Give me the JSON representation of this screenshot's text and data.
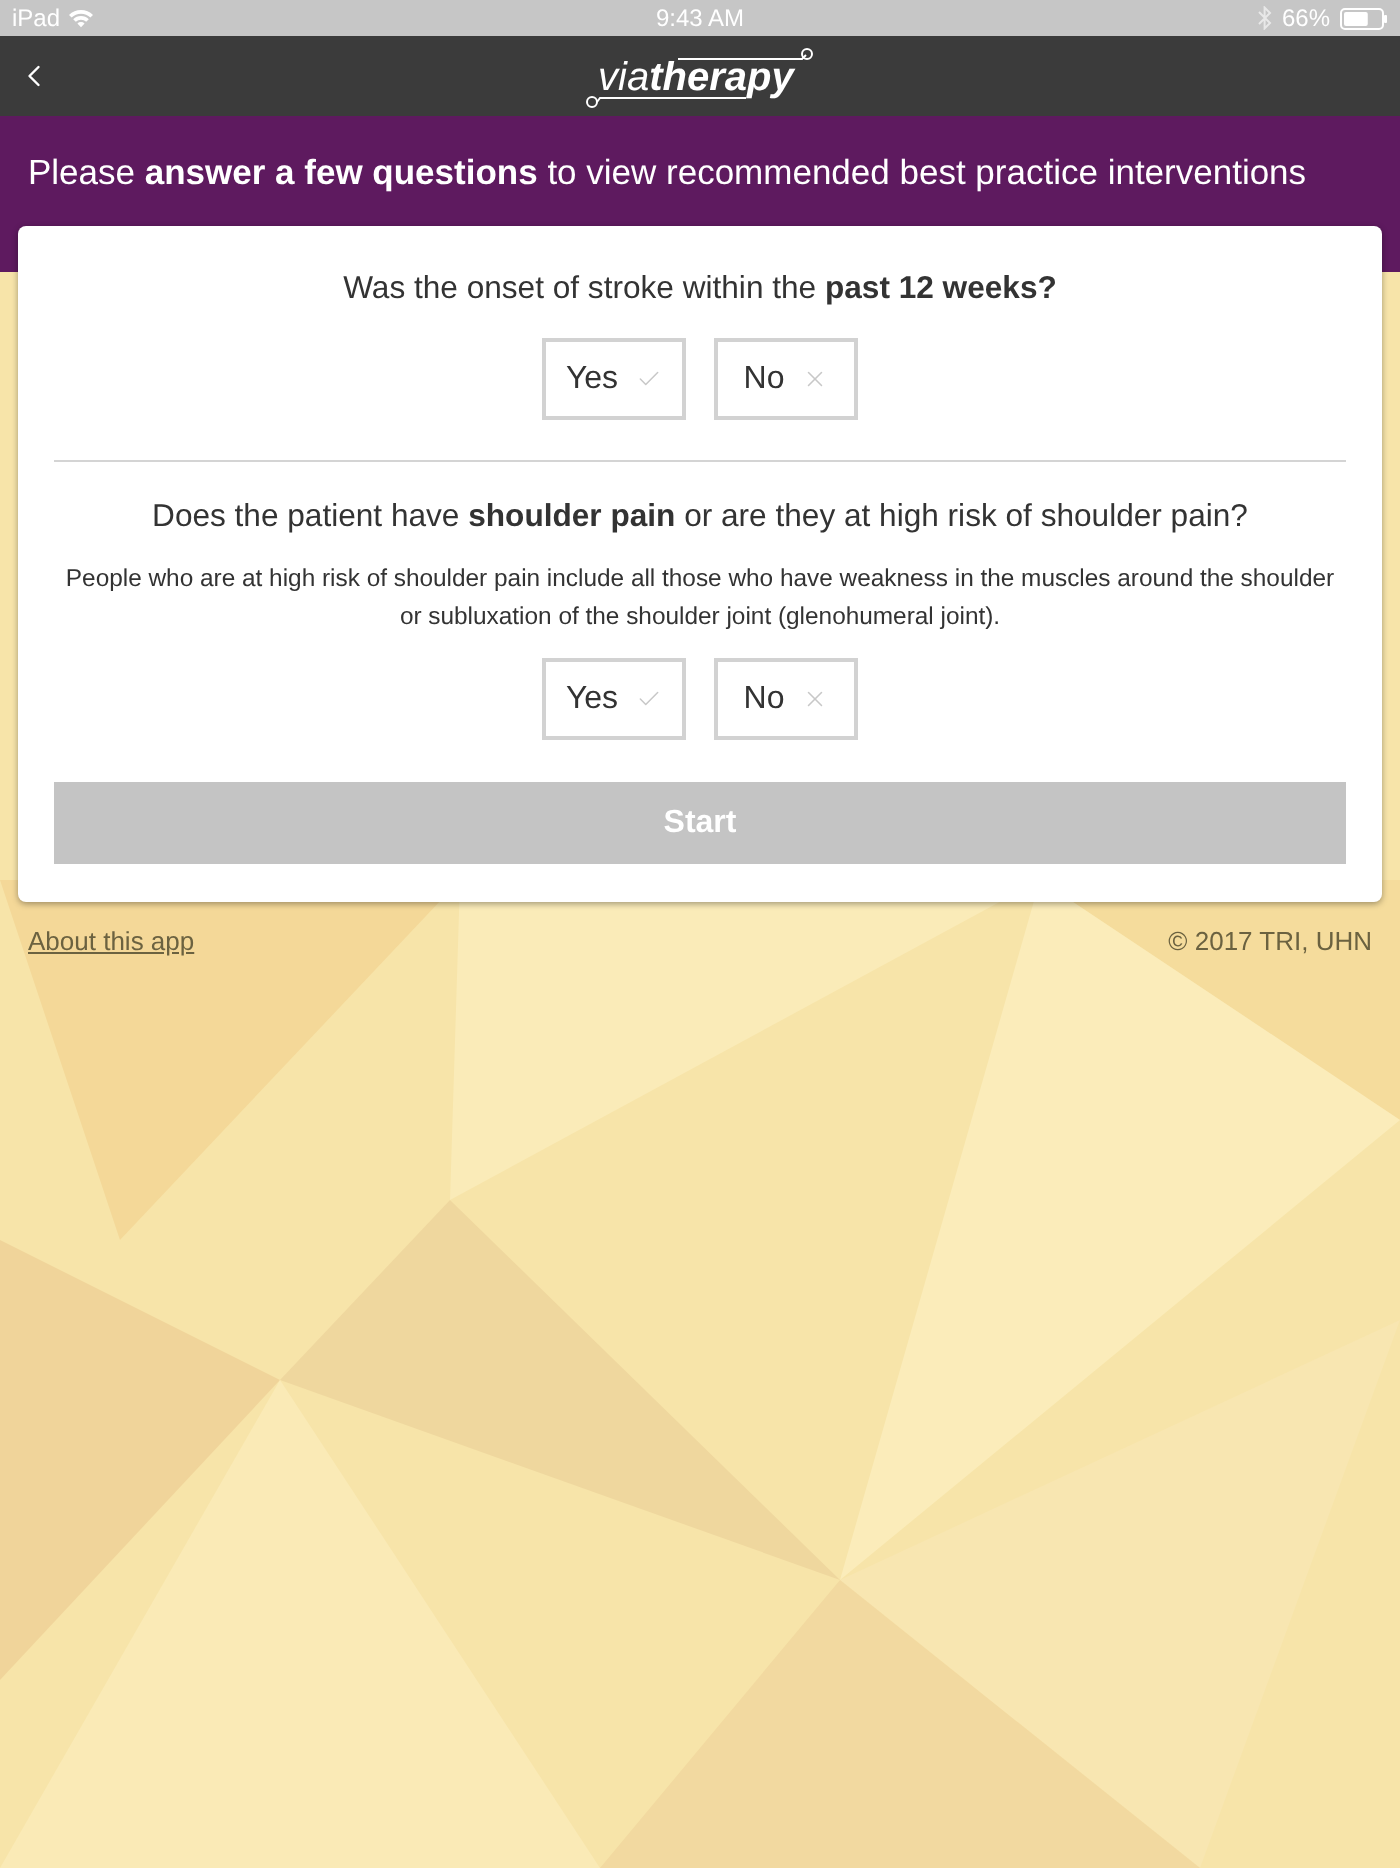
{
  "status_bar": {
    "device": "iPad",
    "time": "9:43 AM",
    "battery": "66%"
  },
  "nav_bar": {
    "logo": "via**therapy**"
  },
  "banner": {
    "text": "Please **answer a few questions** to view recommended best practice interventions"
  },
  "questions": [
    {
      "text": "Was the onset of stroke within the **past 12 weeks?**",
      "options": [
        {
          "label": "Yes",
          "kind": "yes",
          "selected": false
        },
        {
          "label": "No",
          "kind": "no",
          "selected": false
        }
      ]
    },
    {
      "text": "Does the patient have **shoulder pain** or are they at high risk of shoulder pain?",
      "note": "People who are at high risk of shoulder pain include all those who have weakness in the muscles around the shoulder or subluxation of the shoulder joint (glenohumeral joint).",
      "options": [
        {
          "label": "Yes",
          "kind": "yes",
          "selected": false
        },
        {
          "label": "No",
          "kind": "no",
          "selected": false
        }
      ]
    }
  ],
  "start_button": {
    "label": "Start",
    "disabled": true
  },
  "footer": {
    "link": "About this app",
    "copyright": "© 2017 TRI, UHN"
  }
}
